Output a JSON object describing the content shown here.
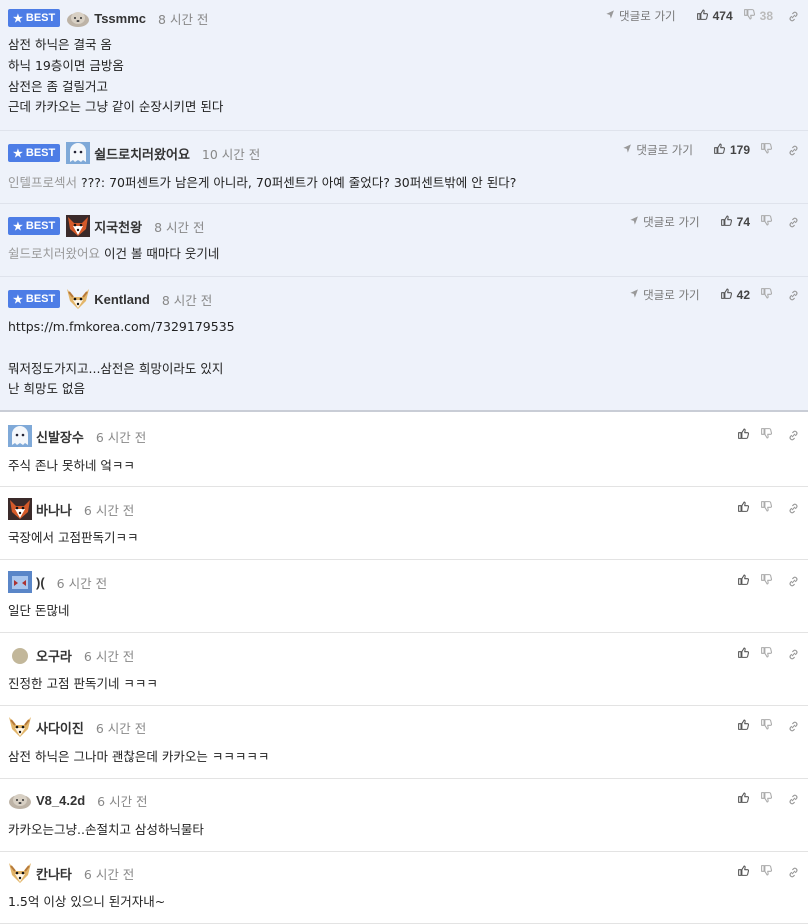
{
  "labels": {
    "best": "BEST",
    "reply": "댓글로 가기"
  },
  "comments": [
    {
      "best": true,
      "avatar": "dog-avatar-gray",
      "nick": "Tssmmc",
      "time": "8 시간 전",
      "likes": "474",
      "dislikes": "38",
      "lines": [
        "삼전 하닉은 결국 옴",
        "하닉 19층이면 금방옴",
        "삼전은 좀 걸릴거고",
        "근데 카카오는 그냥 같이 순장시키면 된다"
      ]
    },
    {
      "best": true,
      "avatar": "blue-ghost-avatar",
      "nick": "쉴드로치러왔어요",
      "time": "10 시간 전",
      "likes": "179",
      "dislikes": "",
      "mention": "인텔프로섹서",
      "text": " ???: 70퍼센트가 남은게 아니라, 70퍼센트가 아예 줄었다? 30퍼센트밖에 안 된다?"
    },
    {
      "best": true,
      "avatar": "red-fox-avatar",
      "nick": "지국천왕",
      "time": "8 시간 전",
      "likes": "74",
      "dislikes": "",
      "mention": "쉴드로치러왔어요",
      "text": " 이건 볼 때마다 웃기네"
    },
    {
      "best": true,
      "avatar": "fennec-avatar",
      "nick": "Kentland",
      "time": "8 시간 전",
      "likes": "42",
      "dislikes": "",
      "lines": [
        "https://m.fmkorea.com/7329179535",
        "",
        "뭐저정도가지고...삼전은 희망이라도 있지",
        "난 희망도 없음"
      ]
    },
    {
      "best": false,
      "avatar": "blue-ghost-avatar",
      "nick": "신발장수",
      "time": "6 시간 전",
      "lines": [
        "주식 존나 못하네 엌ㅋㅋ"
      ]
    },
    {
      "best": false,
      "avatar": "red-fox-avatar",
      "nick": "바나나",
      "time": "6 시간 전",
      "lines": [
        "국장에서 고점판독기ㅋㅋ"
      ]
    },
    {
      "best": false,
      "avatar": "blue-robot-avatar",
      "nick": ")(",
      "time": "6 시간 전",
      "lines": [
        "일단 돈많네"
      ]
    },
    {
      "best": false,
      "avatar": "tan-circle-avatar",
      "nick": "오구라",
      "time": "6 시간 전",
      "lines": [
        "진정한 고점 판독기네 ㅋㅋㅋ"
      ]
    },
    {
      "best": false,
      "avatar": "fennec-avatar",
      "nick": "사다이진",
      "time": "6 시간 전",
      "lines": [
        "삼전 하닉은 그나마 괜찮은데 카카오는 ㅋㅋㅋㅋㅋ"
      ]
    },
    {
      "best": false,
      "avatar": "dog-avatar-gray",
      "nick": "V8_4.2d",
      "time": "6 시간 전",
      "lines": [
        "카카오는그냥..손절치고 삼성하닉물타"
      ]
    },
    {
      "best": false,
      "avatar": "fennec-avatar",
      "nick": "칸나타",
      "time": "6 시간 전",
      "lines": [
        "1.5억 이상 있으니 된거자내~"
      ]
    }
  ],
  "colors": {
    "best_badge": "#4d7de6",
    "best_bg": "#eef2fa",
    "muted": "#888888"
  }
}
